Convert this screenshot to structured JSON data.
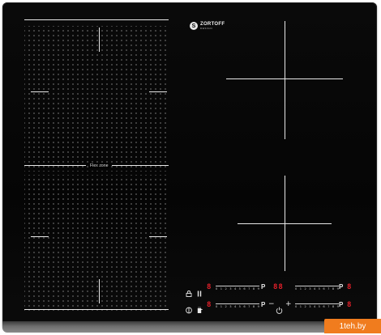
{
  "hob": {
    "flex_zone_label": "Flex zone",
    "brand": {
      "icon": "S",
      "name": "ZORTOFF",
      "sub": "DESIGN"
    }
  },
  "controls": {
    "row1": {
      "lock_icon": "lock-icon",
      "pause_icon": "pause-icon",
      "display_left": "8",
      "slider_left_scale": [
        "0",
        "1",
        "2",
        "3",
        "4",
        "5",
        "6",
        "7",
        "8",
        "9"
      ],
      "boost_left": "P",
      "display_center": "88",
      "slider_right_scale": [
        "0",
        "1",
        "2",
        "3",
        "4",
        "5",
        "6",
        "7",
        "8",
        "9"
      ],
      "boost_right": "P",
      "display_right": "8"
    },
    "row2": {
      "bridge_icon": "bridge-icon",
      "display_left": "8",
      "slider_left_scale": [
        "0",
        "1",
        "2",
        "3",
        "4",
        "5",
        "6",
        "7",
        "8",
        "9"
      ],
      "boost_left": "P",
      "minus": "−",
      "power_icon": "power-icon",
      "plus": "+",
      "slider_right_scale": [
        "0",
        "1",
        "2",
        "3",
        "4",
        "5",
        "6",
        "7",
        "8",
        "9"
      ],
      "boost_right": "P",
      "display_right": "8"
    }
  },
  "watermark": {
    "text": "1teh.by"
  },
  "colors": {
    "glass": "#050505",
    "lines": "#e8e8e8",
    "display": "#e3202a",
    "watermark": "#f07c1e"
  }
}
